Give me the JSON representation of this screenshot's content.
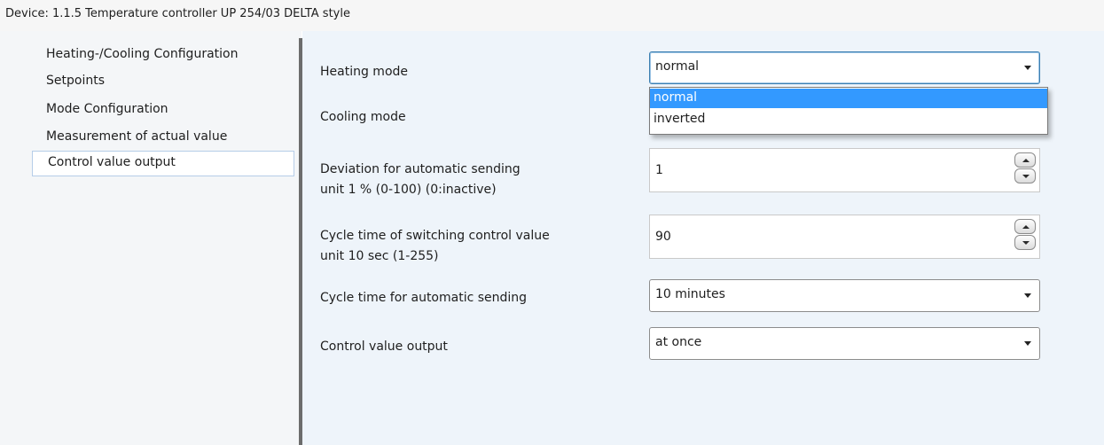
{
  "window": {
    "title": "Device: 1.1.5  Temperature controller UP 254/03 DELTA style"
  },
  "sidebar": {
    "items": [
      {
        "label": "Heating-/Cooling  Configuration"
      },
      {
        "label": "Setpoints"
      },
      {
        "label": "Mode  Configuration"
      },
      {
        "label": "Measurement of actual value"
      },
      {
        "label": "Control value output",
        "selected": true
      }
    ]
  },
  "parameters": {
    "heating_mode": {
      "label": "Heating mode",
      "value": "normal",
      "options": [
        "normal",
        "inverted"
      ],
      "highlighted_option": "normal"
    },
    "cooling_mode": {
      "label": "Cooling mode"
    },
    "deviation": {
      "label_line1": "Deviation for automatic sending",
      "label_line2": "unit 1 %  (0-100)  (0:inactive)",
      "value": "1"
    },
    "cycle_switching": {
      "label_line1": "Cycle time of switching control value",
      "label_line2": "unit 10 sec (1-255)",
      "value": "90"
    },
    "cycle_auto_send": {
      "label": "Cycle time for automatic sending",
      "value": "10 minutes"
    },
    "control_value_output": {
      "label": "Control value output",
      "value": "at once"
    }
  },
  "icons": {
    "dropdown_arrow": "chevron-down-icon",
    "spin_up": "spin-up-icon",
    "spin_down": "spin-down-icon"
  },
  "colors": {
    "selection_highlight": "#3399ff",
    "panel_background": "#eef4fa",
    "sidebar_background": "#f4f6f8"
  }
}
